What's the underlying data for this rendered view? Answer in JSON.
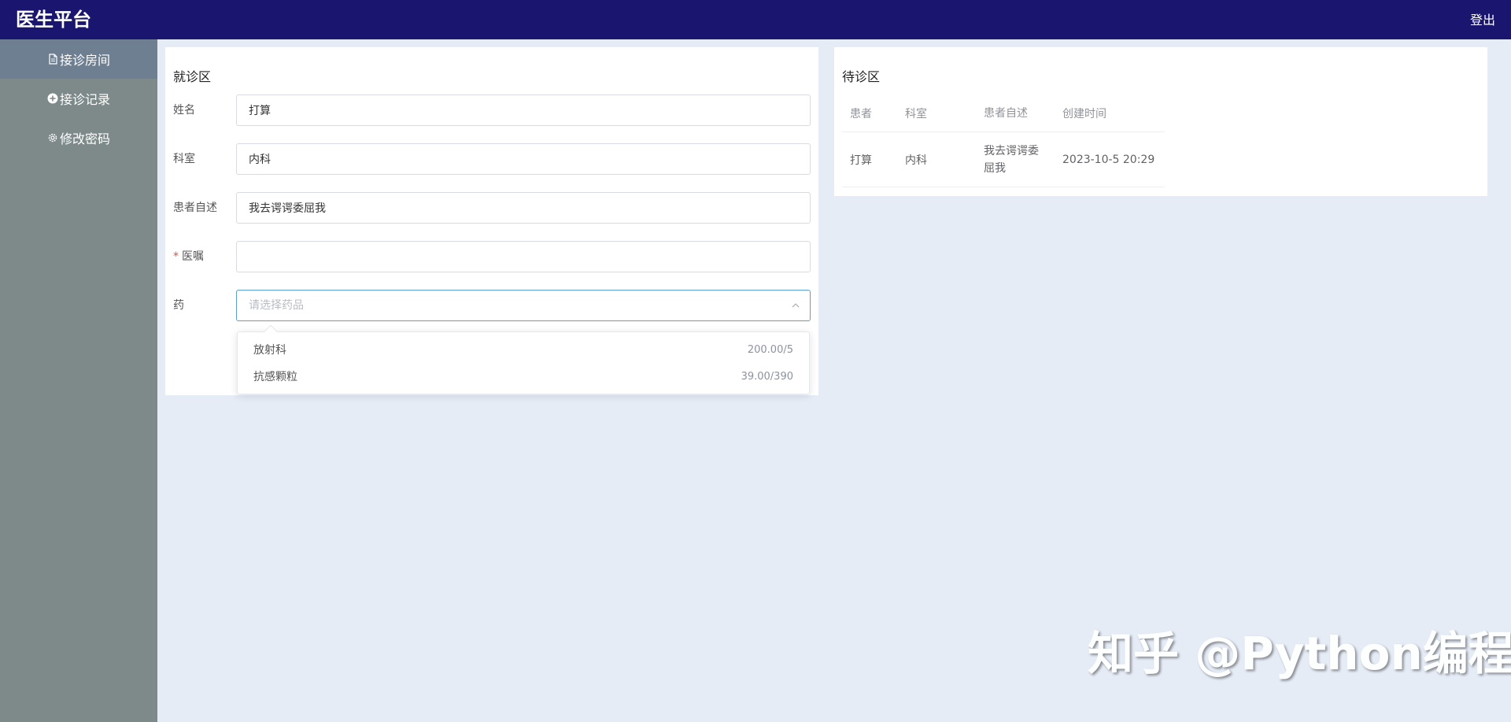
{
  "header": {
    "brand": "医生平台",
    "logout_label": "登出"
  },
  "sidebar": {
    "items": [
      {
        "label": "接诊房间",
        "icon": "document-icon",
        "active": true
      },
      {
        "label": "接诊记录",
        "icon": "plus-circle-icon",
        "active": false
      },
      {
        "label": "修改密码",
        "icon": "gear-icon",
        "active": false
      }
    ]
  },
  "consult": {
    "title": "就诊区",
    "fields": {
      "name": {
        "label": "姓名",
        "value": "打算"
      },
      "dept": {
        "label": "科室",
        "value": "内科"
      },
      "desc": {
        "label": "患者自述",
        "value": "我去谔谔委屈我"
      },
      "advice": {
        "label": "医嘱",
        "required_mark": "*",
        "value": ""
      },
      "medicine": {
        "label": "药",
        "placeholder": "请选择药品"
      }
    },
    "dropdown_options": [
      {
        "name": "放射科",
        "price": "200.00/5"
      },
      {
        "name": "抗感颗粒",
        "price": "39.00/390"
      }
    ]
  },
  "waiting": {
    "title": "待诊区",
    "columns": [
      "患者",
      "科室",
      "患者自述",
      "创建时间"
    ],
    "rows": [
      {
        "patient": "打算",
        "dept": "内科",
        "desc": "我去谔谔委屈我",
        "created": "2023-10-5 20:29"
      }
    ]
  },
  "watermark": "知乎 @Python编程",
  "colors": {
    "topbar": "#1a1670",
    "sidebar": "#7e8a8a",
    "sidebar_active": "#6e7f92",
    "background": "#e6ecf6",
    "select_focus": "#5a9ed6"
  }
}
